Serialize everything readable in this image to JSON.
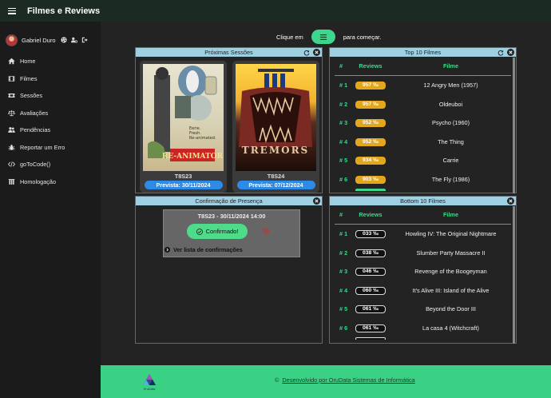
{
  "app": {
    "title": "Filmes e Reviews"
  },
  "user": {
    "name": "Gabriel Duro"
  },
  "nav": [
    {
      "label": "Home",
      "icon": "home-icon"
    },
    {
      "label": "Filmes",
      "icon": "film-icon"
    },
    {
      "label": "Sessões",
      "icon": "ticket-icon"
    },
    {
      "label": "Avaliações",
      "icon": "scale-icon"
    },
    {
      "label": "Pendências",
      "icon": "users-icon"
    },
    {
      "label": "Reportar um Erro",
      "icon": "bug-icon"
    },
    {
      "label": "goToCode()",
      "icon": "code-icon"
    },
    {
      "label": "Homologação",
      "icon": "lab-icon"
    }
  ],
  "start": {
    "before": "Clique em",
    "after": "para começar."
  },
  "sessions_panel": {
    "title": "Próximas Sessões",
    "cards": [
      {
        "code": "T8S23",
        "date": "Prevista: 30/11/2024",
        "poster_text": "RE-ANIMATOR"
      },
      {
        "code": "T8S24",
        "date": "Prevista: 07/12/2024",
        "poster_text": "TREMORS"
      }
    ]
  },
  "confirm_panel": {
    "title": "Confirmação de Presença",
    "session": "T8S23 - 30/11/2024 14:00",
    "confirm_label": "Confirmado!",
    "list_label": "Ver lista de confirmações"
  },
  "top10": {
    "title": "Top 10 Filmes",
    "headers": [
      "#",
      "Reviews",
      "Filme"
    ],
    "rows": [
      {
        "rank": "# 1",
        "score": "957",
        "film": "12 Angry Men (1957)"
      },
      {
        "rank": "# 2",
        "score": "957",
        "film": "Oldeuboi"
      },
      {
        "rank": "# 3",
        "score": "952",
        "film": "Psycho (1960)"
      },
      {
        "rank": "# 4",
        "score": "952",
        "film": "The Thing"
      },
      {
        "rank": "# 5",
        "score": "934",
        "film": "Carrie"
      },
      {
        "rank": "# 6",
        "score": "903",
        "film": "The Fly (1986)"
      }
    ]
  },
  "bottom10": {
    "title": "Bottom 10 Filmes",
    "headers": [
      "#",
      "Reviews",
      "Filme"
    ],
    "rows": [
      {
        "rank": "# 1",
        "score": "033",
        "film": "Howling IV: The Original Nightmare"
      },
      {
        "rank": "# 2",
        "score": "038",
        "film": "Slumber Party Massacre II"
      },
      {
        "rank": "# 3",
        "score": "046",
        "film": "Revenge of the Boogeyman"
      },
      {
        "rank": "# 4",
        "score": "060",
        "film": "It's Alive III: Island of the Alive"
      },
      {
        "rank": "# 5",
        "score": "061",
        "film": "Beyond the Door III"
      },
      {
        "rank": "# 6",
        "score": "061",
        "film": "La casa 4 (Witchcraft)"
      }
    ]
  },
  "permille": "‰",
  "footer": {
    "symbol": "©",
    "text": "Desenvolvido por OruData Sistemas de Informática",
    "logo_text": "OruData"
  },
  "colors": {
    "accent": "#3dd68c",
    "gold": "#e2a71d",
    "blue": "#2d8ae6",
    "panel_header": "#9fd0e2"
  }
}
